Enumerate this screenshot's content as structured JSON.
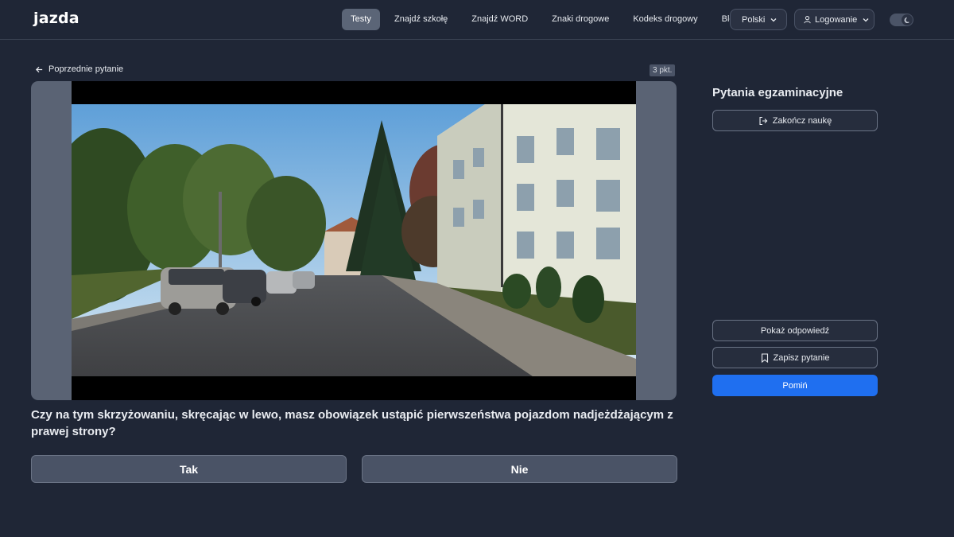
{
  "header": {
    "logo": "jazda",
    "nav": [
      "Testy",
      "Znajdź szkołę",
      "Znajdź WORD",
      "Znaki drogowe",
      "Kodeks drogowy",
      "Blog"
    ],
    "language": "Polski",
    "login": "Logowanie"
  },
  "question": {
    "prev_label": "Poprzednie pytanie",
    "points": "3 pkt.",
    "text": "Czy na tym skrzyżowaniu, skręcając w lewo, masz obowiązek ustąpić pierwszeństwa pojazdom nadjeżdżającym z prawej strony?",
    "answers": [
      "Tak",
      "Nie"
    ]
  },
  "sidebar": {
    "title": "Pytania egzaminacyjne",
    "finish_label": "Zakończ naukę",
    "show_answer_label": "Pokaż odpowiedź",
    "save_label": "Zapisz pytanie",
    "skip_label": "Pomiń"
  },
  "colors": {
    "background": "#1f2636",
    "accent": "#1f6ff0",
    "active_nav": "#5b6577"
  },
  "icons": [
    "arrow-left-icon",
    "chevron-down-icon",
    "user-icon",
    "moon-icon",
    "logout-icon",
    "bookmark-icon"
  ]
}
